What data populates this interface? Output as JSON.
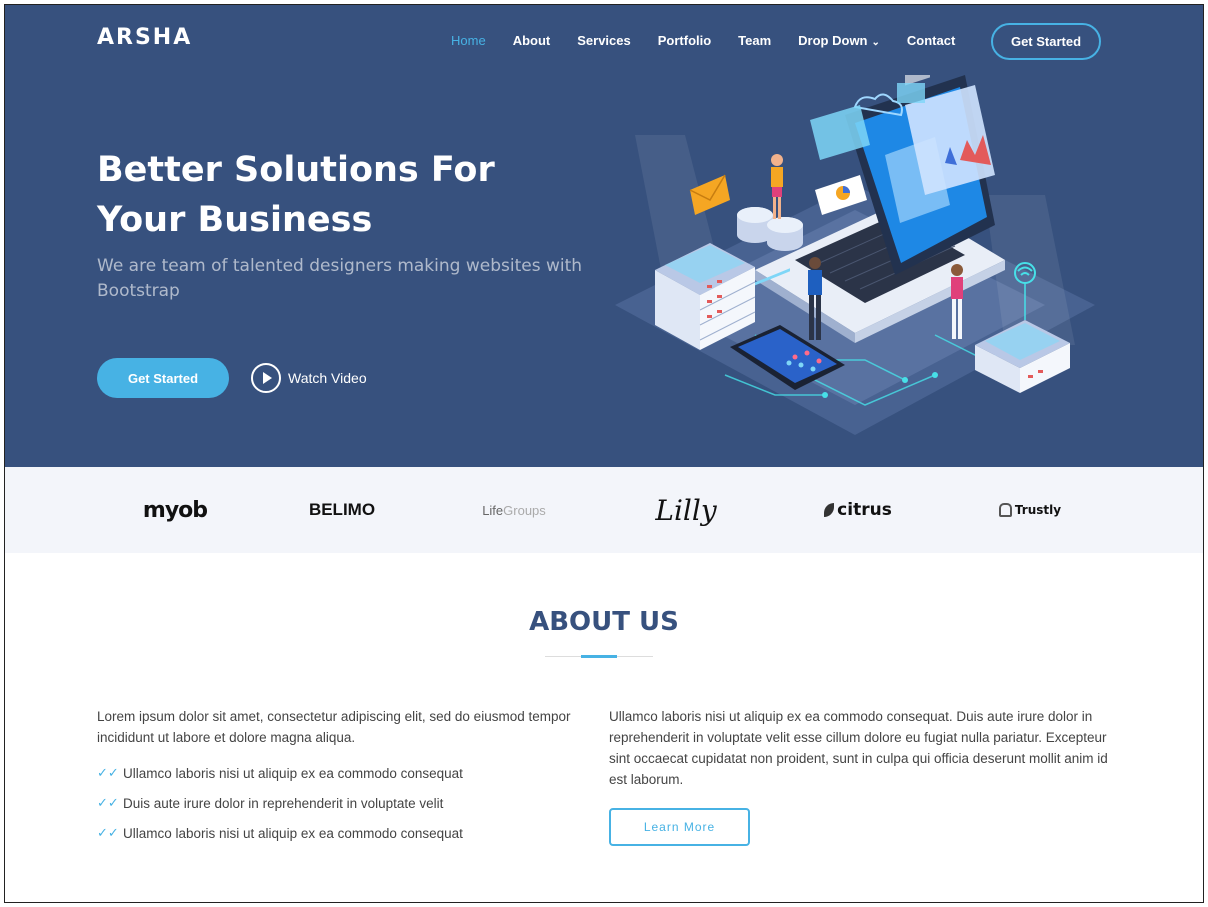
{
  "header": {
    "logo": "ARSHA",
    "nav": [
      {
        "label": "Home",
        "active": true
      },
      {
        "label": "About"
      },
      {
        "label": "Services"
      },
      {
        "label": "Portfolio"
      },
      {
        "label": "Team"
      },
      {
        "label": "Drop Down",
        "dropdown": true
      },
      {
        "label": "Contact"
      }
    ],
    "cta_label": "Get Started"
  },
  "hero": {
    "title_line1": "Better Solutions For",
    "title_line2": "Your Business",
    "subtitle": "We are team of talented designers making websites with Bootstrap",
    "primary_button": "Get Started",
    "video_button": "Watch Video"
  },
  "clients": [
    {
      "name": "myob"
    },
    {
      "name": "BELIMO"
    },
    {
      "name": "Life",
      "suffix": "Groups"
    },
    {
      "name": "Lilly"
    },
    {
      "name": "citrus"
    },
    {
      "name": "Trustly"
    }
  ],
  "about": {
    "title": "ABOUT US",
    "intro": "Lorem ipsum dolor sit amet, consectetur adipiscing elit, sed do eiusmod tempor incididunt ut labore et dolore magna aliqua.",
    "list": [
      "Ullamco laboris nisi ut aliquip ex ea commodo consequat",
      "Duis aute irure dolor in reprehenderit in voluptate velit",
      "Ullamco laboris nisi ut aliquip ex ea commodo consequat"
    ],
    "right_text": "Ullamco laboris nisi ut aliquip ex ea commodo consequat. Duis aute irure dolor in reprehenderit in voluptate velit esse cillum dolore eu fugiat nulla pariatur. Excepteur sint occaecat cupidatat non proident, sunt in culpa qui officia deserunt mollit anim id est laborum.",
    "learn_more": "Learn More"
  },
  "colors": {
    "hero_bg": "#37517e",
    "accent": "#47b2e4",
    "clients_bg": "#f3f5fa"
  }
}
